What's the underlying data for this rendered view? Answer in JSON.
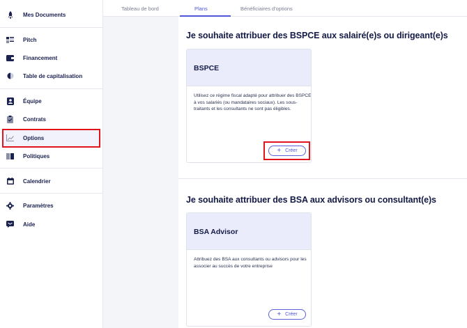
{
  "sidebar": {
    "items": [
      {
        "label": "Mes Documents",
        "icon": "rocket-icon"
      },
      {
        "label": "Pitch",
        "icon": "slides-icon"
      },
      {
        "label": "Financement",
        "icon": "wallet-icon"
      },
      {
        "label": "Table de capitalisation",
        "icon": "pie-chart-icon"
      },
      {
        "label": "Équipe",
        "icon": "person-card-icon"
      },
      {
        "label": "Contrats",
        "icon": "clipboard-icon"
      },
      {
        "label": "Options",
        "icon": "chart-line-icon"
      },
      {
        "label": "Politiques",
        "icon": "book-icon"
      },
      {
        "label": "Calendrier",
        "icon": "calendar-icon"
      },
      {
        "label": "Paramètres",
        "icon": "gear-icon"
      },
      {
        "label": "Aide",
        "icon": "chat-icon"
      }
    ]
  },
  "tabs": [
    {
      "label": "Tableau de bord"
    },
    {
      "label": "Plans"
    },
    {
      "label": "Bénéficiaires d'options"
    }
  ],
  "sections": [
    {
      "title": "Je souhaite attribuer des BSPCE aux salairé(e)s ou dirigeant(e)s",
      "card_title": "BSPCE",
      "card_description": "Utilisez ce régime fiscal adapté pour attribuer des BSPCE à vos salariés (ou mandataires sociaux). Les sous-traitants et les consultants ne sont pas éligibles.",
      "button_label": "Créer"
    },
    {
      "title": "Je souhaite attribuer des BSA aux advisors ou consultant(e)s",
      "card_title": "BSA Advisor",
      "card_description": "Attribuez des BSA aux consultants ou advisors pour les associer au succès de votre entreprise",
      "button_label": "Créer"
    }
  ],
  "colors": {
    "accent": "#4e55d8",
    "highlight_red": "#e3131b",
    "card_header": "#ebecfb",
    "text_dark": "#131a45"
  }
}
